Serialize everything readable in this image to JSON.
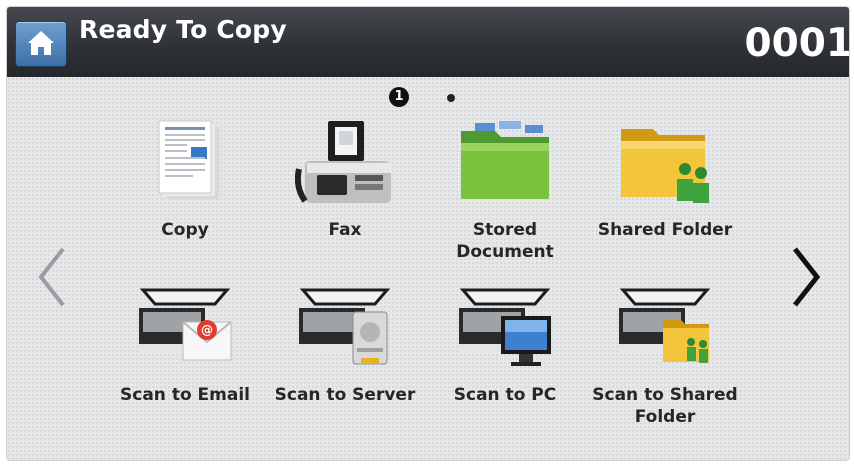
{
  "header": {
    "title": "Ready To Copy",
    "counter": "0001"
  },
  "pager": {
    "current_page": "1",
    "total_pages": 2
  },
  "apps": [
    {
      "label": "Copy",
      "icon": "copy-document-icon"
    },
    {
      "label": "Fax",
      "icon": "fax-machine-icon"
    },
    {
      "label_line1": "Stored",
      "label_line2": "Document",
      "icon": "green-folder-icon"
    },
    {
      "label": "Shared Folder",
      "icon": "shared-folder-icon"
    },
    {
      "label": "Scan to Email",
      "icon": "scan-to-email-icon"
    },
    {
      "label": "Scan to Server",
      "icon": "scan-to-server-icon"
    },
    {
      "label": "Scan to PC",
      "icon": "scan-to-pc-icon"
    },
    {
      "label_line1": "Scan to Shared",
      "label_line2": "Folder",
      "icon": "scan-to-shared-folder-icon"
    }
  ],
  "colors": {
    "header_bg": "#2f3236",
    "home_button": "#4f80b8",
    "content_bg": "#e6e7e9",
    "label_text": "#262626"
  }
}
